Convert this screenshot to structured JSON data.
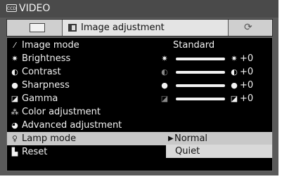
{
  "window": {
    "title": "VIDEO",
    "video_icon_label": "CCD"
  },
  "tabs": [
    {
      "name": "screen"
    },
    {
      "name": "image-adjustment",
      "label": "Image adjustment"
    },
    {
      "name": "rotate"
    }
  ],
  "menu": {
    "items": [
      {
        "label": "Image mode",
        "icon": "image-mode-icon",
        "value": "Standard"
      },
      {
        "label": "Brightness",
        "icon": "brightness-icon",
        "value": "+0",
        "slider": true
      },
      {
        "label": "Contrast",
        "icon": "contrast-icon",
        "value": "+0",
        "slider": true
      },
      {
        "label": "Sharpness",
        "icon": "sharpness-icon",
        "value": "+0",
        "slider": true
      },
      {
        "label": "Gamma",
        "icon": "gamma-icon",
        "value": "+0",
        "slider": true
      },
      {
        "label": "Color adjustment",
        "icon": "color-adjustment-icon"
      },
      {
        "label": "Advanced adjustment",
        "icon": "advanced-adjustment-icon"
      },
      {
        "label": "Lamp mode",
        "icon": "lamp-icon",
        "selected": true
      },
      {
        "label": "Reset",
        "icon": "reset-icon"
      }
    ],
    "lamp_options": {
      "selected": "Normal",
      "other": "Quiet"
    }
  }
}
